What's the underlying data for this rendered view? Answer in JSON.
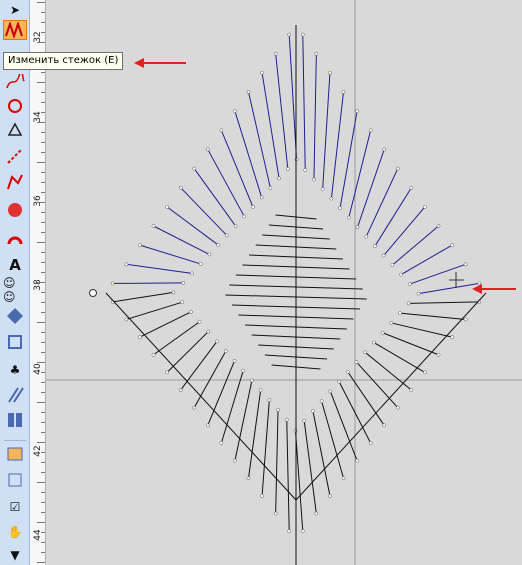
{
  "tooltip": {
    "text": "Изменить стежок (E)"
  },
  "ruler": {
    "labels": [
      "32",
      "34",
      "36",
      "38",
      "40",
      "42",
      "44"
    ]
  },
  "toolbar": {
    "icons": [
      "select-arrow-icon",
      "zigzag-stitch-icon",
      "edit-stitch-icon",
      "run-stitch-icon",
      "satin-icon",
      "node-edit-icon",
      "line-icon",
      "polyline-icon",
      "sphere-icon",
      "arch-icon",
      "text-icon",
      "people-icon",
      "badge-icon",
      "square-icon",
      "figure-icon",
      "lines-icon",
      "grid-icon",
      "picture-icon",
      "frame-icon",
      "check-icon",
      "hand-icon",
      "arrow-down-icon"
    ]
  },
  "colors": {
    "blue_thread": "#1f1f8f",
    "black_thread": "#111111",
    "arrow": "#e02020",
    "guides": "#9a9a9a"
  }
}
